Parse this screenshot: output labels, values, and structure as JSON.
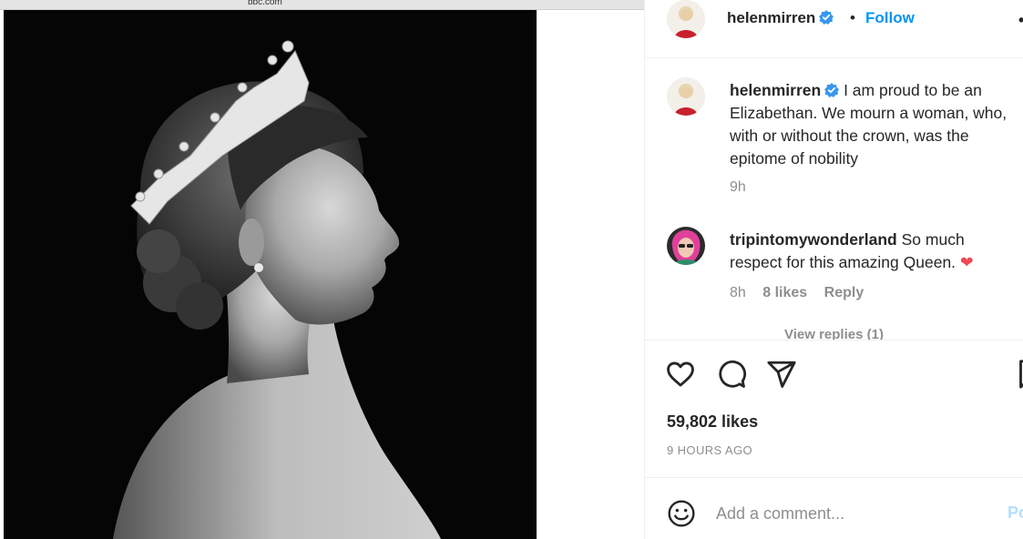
{
  "media": {
    "source_url": "bbc.com"
  },
  "header": {
    "username": "helenmirren",
    "separator": "•",
    "follow_label": "Follow",
    "more": "•"
  },
  "comments": [
    {
      "username": "helenmirren",
      "text": "I am proud to be an Elizabethan. We mourn a woman, who, with or without the crown, was the epitome of nobility",
      "time": "9h"
    },
    {
      "username": "tripintomywonderland",
      "text": "So much respect for this amazing Queen.",
      "emoji": "❤",
      "time": "8h",
      "likes": "8 likes",
      "reply_label": "Reply",
      "view_replies": "View replies (1)"
    }
  ],
  "actions": {
    "likes": "59,802 likes",
    "time_ago": "9 HOURS AGO",
    "icons": [
      "heart-icon",
      "comment-icon",
      "share-icon",
      "bookmark-icon"
    ]
  },
  "add_comment": {
    "placeholder": "Add a comment...",
    "post_label": "Post"
  },
  "colors": {
    "follow": "#0095f6",
    "verified": "#3897f0",
    "heart_emoji": "#ed4956",
    "meta_gray": "#8e8e8e"
  }
}
